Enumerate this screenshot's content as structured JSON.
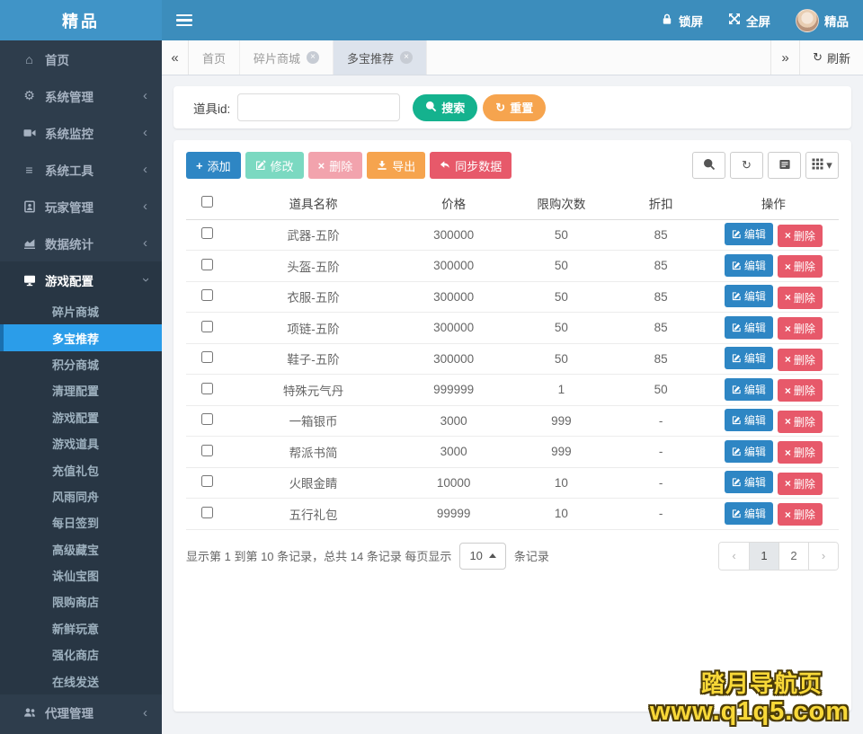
{
  "brand": {
    "title": "精品"
  },
  "topbar": {
    "lock_label": "锁屏",
    "fullscreen_label": "全屏",
    "username": "精品"
  },
  "glyphs": {
    "back": "«",
    "forward": "»",
    "refresh": "↻",
    "prev": "‹",
    "next": "›",
    "chevron_left": "‹",
    "caret_down": "▾",
    "home": "⌂",
    "gear": "⚙",
    "list": "≡",
    "plus": "+",
    "close": "×",
    "x": "×"
  },
  "sidebar": {
    "items": [
      {
        "label": "首页"
      },
      {
        "label": "系统管理"
      },
      {
        "label": "系统监控"
      },
      {
        "label": "系统工具"
      },
      {
        "label": "玩家管理"
      },
      {
        "label": "数据统计"
      },
      {
        "label": "游戏配置"
      }
    ],
    "submenu": [
      "碎片商城",
      "多宝推荐",
      "积分商城",
      "清理配置",
      "游戏配置",
      "游戏道具",
      "充值礼包",
      "风雨同舟",
      "每日签到",
      "高级藏宝",
      "诛仙宝图",
      "限购商店",
      "新鲜玩意",
      "强化商店",
      "在线发送"
    ],
    "active_submenu": "多宝推荐",
    "agent_label": "代理管理"
  },
  "tabs": {
    "items": [
      {
        "label": "首页"
      },
      {
        "label": "碎片商城"
      },
      {
        "label": "多宝推荐"
      }
    ],
    "active_tab": "多宝推荐",
    "refresh_label": "刷新"
  },
  "search": {
    "label": "道具id:",
    "input_value": "",
    "search_label": "搜索",
    "reset_label": "重置"
  },
  "toolbar": {
    "add_label": "添加",
    "modify_label": "修改",
    "remove_label": "删除",
    "export_label": "导出",
    "sync_label": "同步数据"
  },
  "table": {
    "headers": [
      "道具名称",
      "价格",
      "限购次数",
      "折扣",
      "操作"
    ],
    "actions": {
      "edit": "编辑",
      "delete": "删除"
    },
    "rows": [
      {
        "name": "武器-五阶",
        "price": "300000",
        "limit": "50",
        "discount": "85"
      },
      {
        "name": "头盔-五阶",
        "price": "300000",
        "limit": "50",
        "discount": "85"
      },
      {
        "name": "衣服-五阶",
        "price": "300000",
        "limit": "50",
        "discount": "85"
      },
      {
        "name": "项链-五阶",
        "price": "300000",
        "limit": "50",
        "discount": "85"
      },
      {
        "name": "鞋子-五阶",
        "price": "300000",
        "limit": "50",
        "discount": "85"
      },
      {
        "name": "特殊元气丹",
        "price": "999999",
        "limit": "1",
        "discount": "50"
      },
      {
        "name": "一箱银币",
        "price": "3000",
        "limit": "999",
        "discount": "-"
      },
      {
        "name": "帮派书简",
        "price": "3000",
        "limit": "999",
        "discount": "-"
      },
      {
        "name": "火眼金睛",
        "price": "10000",
        "limit": "10",
        "discount": "-"
      },
      {
        "name": "五行礼包",
        "price": "99999",
        "limit": "10",
        "discount": "-"
      }
    ]
  },
  "pagination": {
    "info_left": "显示第 1 到第 10 条记录，总共 14 条记录 每页显示",
    "page_size": "10",
    "info_right": "条记录",
    "pages": [
      "1",
      "2"
    ],
    "active_page": "1"
  },
  "watermark": {
    "line1": "踏月导航页",
    "line2": "www.q1q5.com"
  },
  "colors": {
    "topbar": "#3c8dbc",
    "sidebar": "#2e3d4c",
    "submenu_bg": "#283644",
    "active_item": "#2b9de9",
    "primary": "#2e86c4",
    "success": "#14b28e",
    "warning": "#f6a44e",
    "danger": "#e7596a",
    "watermark_yellow": "#f8d838"
  }
}
